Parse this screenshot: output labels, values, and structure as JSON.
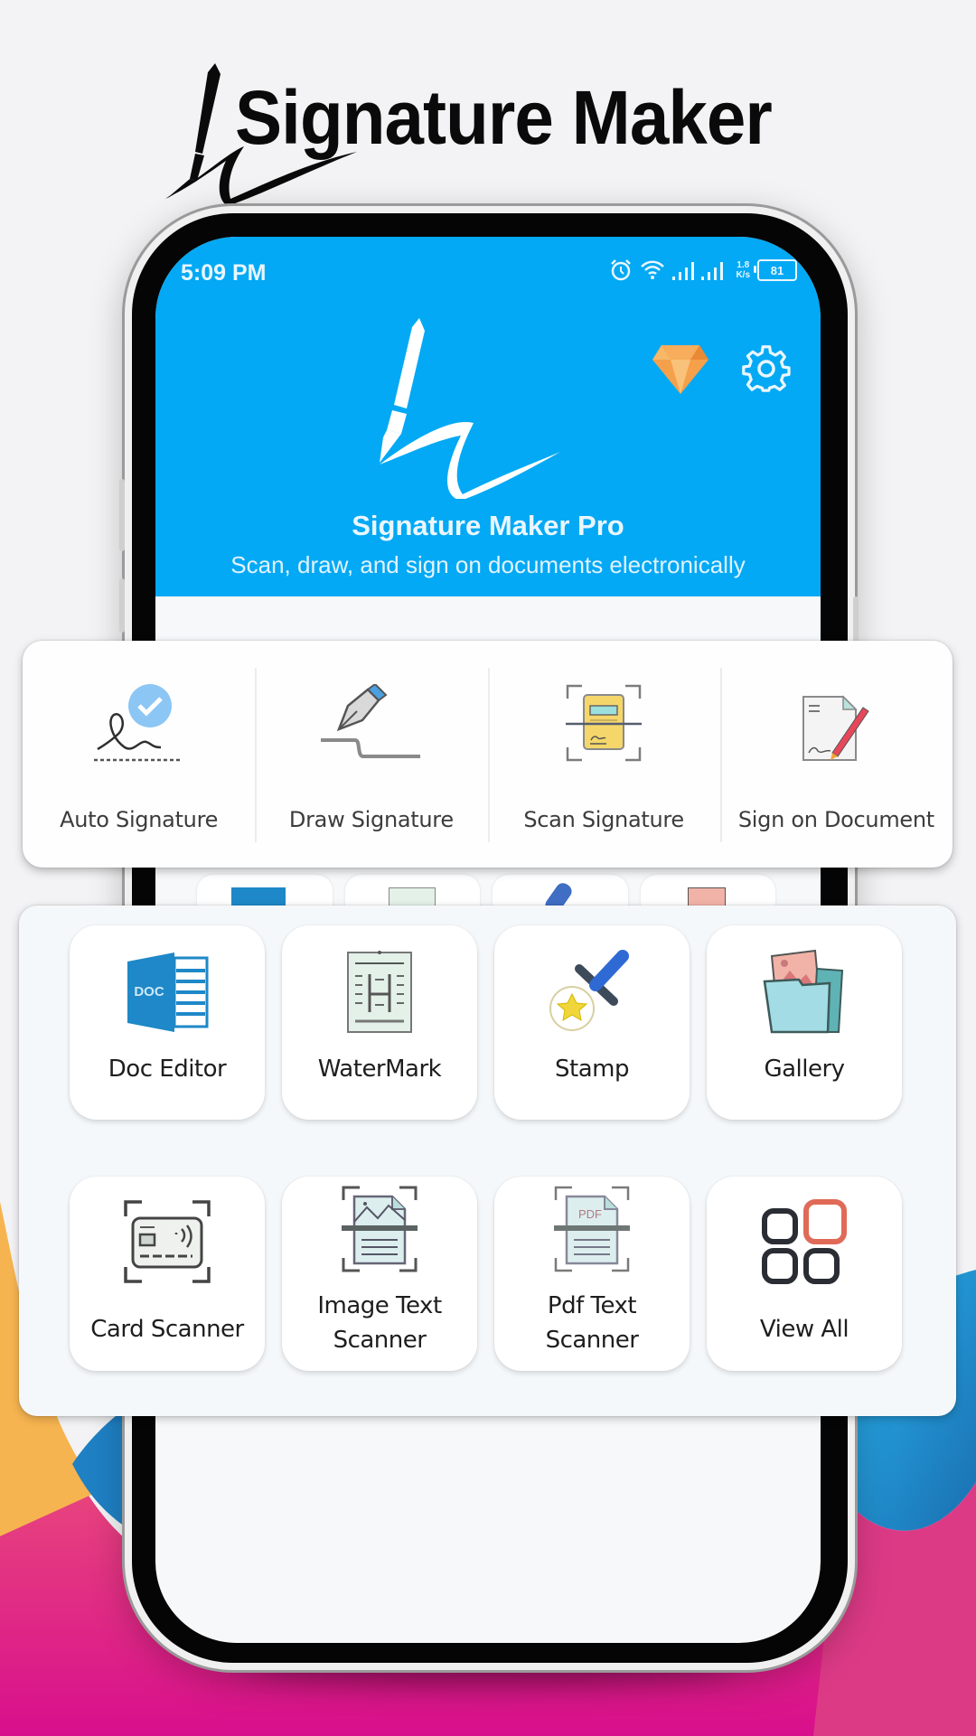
{
  "promo": {
    "title": "Signature Maker"
  },
  "status_bar": {
    "time": "5:09 PM",
    "net_speed_value": "1.8",
    "net_speed_unit": "K/s",
    "battery": "81"
  },
  "app": {
    "name": "Signature Maker Pro",
    "tagline": "Scan, draw,  and sign on documents electronically",
    "header_color": "#03a9f4"
  },
  "signature_actions": [
    {
      "label": "Auto Signature",
      "icon": "auto-signature-icon"
    },
    {
      "label": "Draw Signature",
      "icon": "pen-nib-icon"
    },
    {
      "label": "Scan Signature",
      "icon": "scan-document-icon"
    },
    {
      "label": "Sign on Document",
      "icon": "sign-document-icon"
    }
  ],
  "tools": [
    {
      "label": "Doc Editor",
      "icon": "doc-file-icon"
    },
    {
      "label": "WaterMark",
      "icon": "watermark-icon"
    },
    {
      "label": "Stamp",
      "icon": "stamp-icon"
    },
    {
      "label": "Gallery",
      "icon": "gallery-folder-icon"
    },
    {
      "label": "Card Scanner",
      "icon": "card-scanner-icon"
    },
    {
      "label_line1": "Image Text",
      "label_line2": "Scanner",
      "icon": "image-scan-icon"
    },
    {
      "label_line1": "Pdf Text",
      "label_line2": "Scanner",
      "icon": "pdf-scan-icon"
    },
    {
      "label": "View All",
      "icon": "grid-icon"
    }
  ]
}
